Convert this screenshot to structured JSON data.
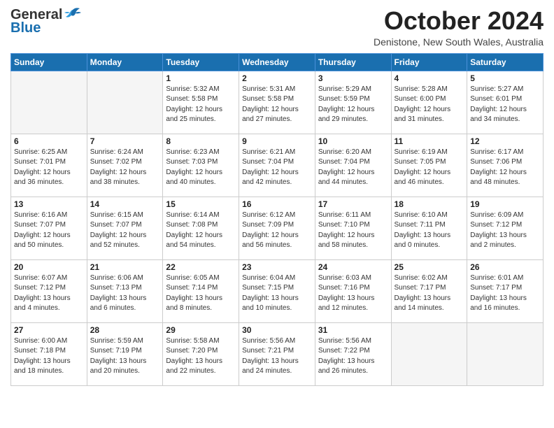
{
  "header": {
    "logo_general": "General",
    "logo_blue": "Blue",
    "month_title": "October 2024",
    "location": "Denistone, New South Wales, Australia"
  },
  "days_of_week": [
    "Sunday",
    "Monday",
    "Tuesday",
    "Wednesday",
    "Thursday",
    "Friday",
    "Saturday"
  ],
  "weeks": [
    [
      {
        "day": "",
        "info": ""
      },
      {
        "day": "",
        "info": ""
      },
      {
        "day": "1",
        "info": "Sunrise: 5:32 AM\nSunset: 5:58 PM\nDaylight: 12 hours\nand 25 minutes."
      },
      {
        "day": "2",
        "info": "Sunrise: 5:31 AM\nSunset: 5:58 PM\nDaylight: 12 hours\nand 27 minutes."
      },
      {
        "day": "3",
        "info": "Sunrise: 5:29 AM\nSunset: 5:59 PM\nDaylight: 12 hours\nand 29 minutes."
      },
      {
        "day": "4",
        "info": "Sunrise: 5:28 AM\nSunset: 6:00 PM\nDaylight: 12 hours\nand 31 minutes."
      },
      {
        "day": "5",
        "info": "Sunrise: 5:27 AM\nSunset: 6:01 PM\nDaylight: 12 hours\nand 34 minutes."
      }
    ],
    [
      {
        "day": "6",
        "info": "Sunrise: 6:25 AM\nSunset: 7:01 PM\nDaylight: 12 hours\nand 36 minutes."
      },
      {
        "day": "7",
        "info": "Sunrise: 6:24 AM\nSunset: 7:02 PM\nDaylight: 12 hours\nand 38 minutes."
      },
      {
        "day": "8",
        "info": "Sunrise: 6:23 AM\nSunset: 7:03 PM\nDaylight: 12 hours\nand 40 minutes."
      },
      {
        "day": "9",
        "info": "Sunrise: 6:21 AM\nSunset: 7:04 PM\nDaylight: 12 hours\nand 42 minutes."
      },
      {
        "day": "10",
        "info": "Sunrise: 6:20 AM\nSunset: 7:04 PM\nDaylight: 12 hours\nand 44 minutes."
      },
      {
        "day": "11",
        "info": "Sunrise: 6:19 AM\nSunset: 7:05 PM\nDaylight: 12 hours\nand 46 minutes."
      },
      {
        "day": "12",
        "info": "Sunrise: 6:17 AM\nSunset: 7:06 PM\nDaylight: 12 hours\nand 48 minutes."
      }
    ],
    [
      {
        "day": "13",
        "info": "Sunrise: 6:16 AM\nSunset: 7:07 PM\nDaylight: 12 hours\nand 50 minutes."
      },
      {
        "day": "14",
        "info": "Sunrise: 6:15 AM\nSunset: 7:07 PM\nDaylight: 12 hours\nand 52 minutes."
      },
      {
        "day": "15",
        "info": "Sunrise: 6:14 AM\nSunset: 7:08 PM\nDaylight: 12 hours\nand 54 minutes."
      },
      {
        "day": "16",
        "info": "Sunrise: 6:12 AM\nSunset: 7:09 PM\nDaylight: 12 hours\nand 56 minutes."
      },
      {
        "day": "17",
        "info": "Sunrise: 6:11 AM\nSunset: 7:10 PM\nDaylight: 12 hours\nand 58 minutes."
      },
      {
        "day": "18",
        "info": "Sunrise: 6:10 AM\nSunset: 7:11 PM\nDaylight: 13 hours\nand 0 minutes."
      },
      {
        "day": "19",
        "info": "Sunrise: 6:09 AM\nSunset: 7:12 PM\nDaylight: 13 hours\nand 2 minutes."
      }
    ],
    [
      {
        "day": "20",
        "info": "Sunrise: 6:07 AM\nSunset: 7:12 PM\nDaylight: 13 hours\nand 4 minutes."
      },
      {
        "day": "21",
        "info": "Sunrise: 6:06 AM\nSunset: 7:13 PM\nDaylight: 13 hours\nand 6 minutes."
      },
      {
        "day": "22",
        "info": "Sunrise: 6:05 AM\nSunset: 7:14 PM\nDaylight: 13 hours\nand 8 minutes."
      },
      {
        "day": "23",
        "info": "Sunrise: 6:04 AM\nSunset: 7:15 PM\nDaylight: 13 hours\nand 10 minutes."
      },
      {
        "day": "24",
        "info": "Sunrise: 6:03 AM\nSunset: 7:16 PM\nDaylight: 13 hours\nand 12 minutes."
      },
      {
        "day": "25",
        "info": "Sunrise: 6:02 AM\nSunset: 7:17 PM\nDaylight: 13 hours\nand 14 minutes."
      },
      {
        "day": "26",
        "info": "Sunrise: 6:01 AM\nSunset: 7:17 PM\nDaylight: 13 hours\nand 16 minutes."
      }
    ],
    [
      {
        "day": "27",
        "info": "Sunrise: 6:00 AM\nSunset: 7:18 PM\nDaylight: 13 hours\nand 18 minutes."
      },
      {
        "day": "28",
        "info": "Sunrise: 5:59 AM\nSunset: 7:19 PM\nDaylight: 13 hours\nand 20 minutes."
      },
      {
        "day": "29",
        "info": "Sunrise: 5:58 AM\nSunset: 7:20 PM\nDaylight: 13 hours\nand 22 minutes."
      },
      {
        "day": "30",
        "info": "Sunrise: 5:56 AM\nSunset: 7:21 PM\nDaylight: 13 hours\nand 24 minutes."
      },
      {
        "day": "31",
        "info": "Sunrise: 5:56 AM\nSunset: 7:22 PM\nDaylight: 13 hours\nand 26 minutes."
      },
      {
        "day": "",
        "info": ""
      },
      {
        "day": "",
        "info": ""
      }
    ]
  ]
}
